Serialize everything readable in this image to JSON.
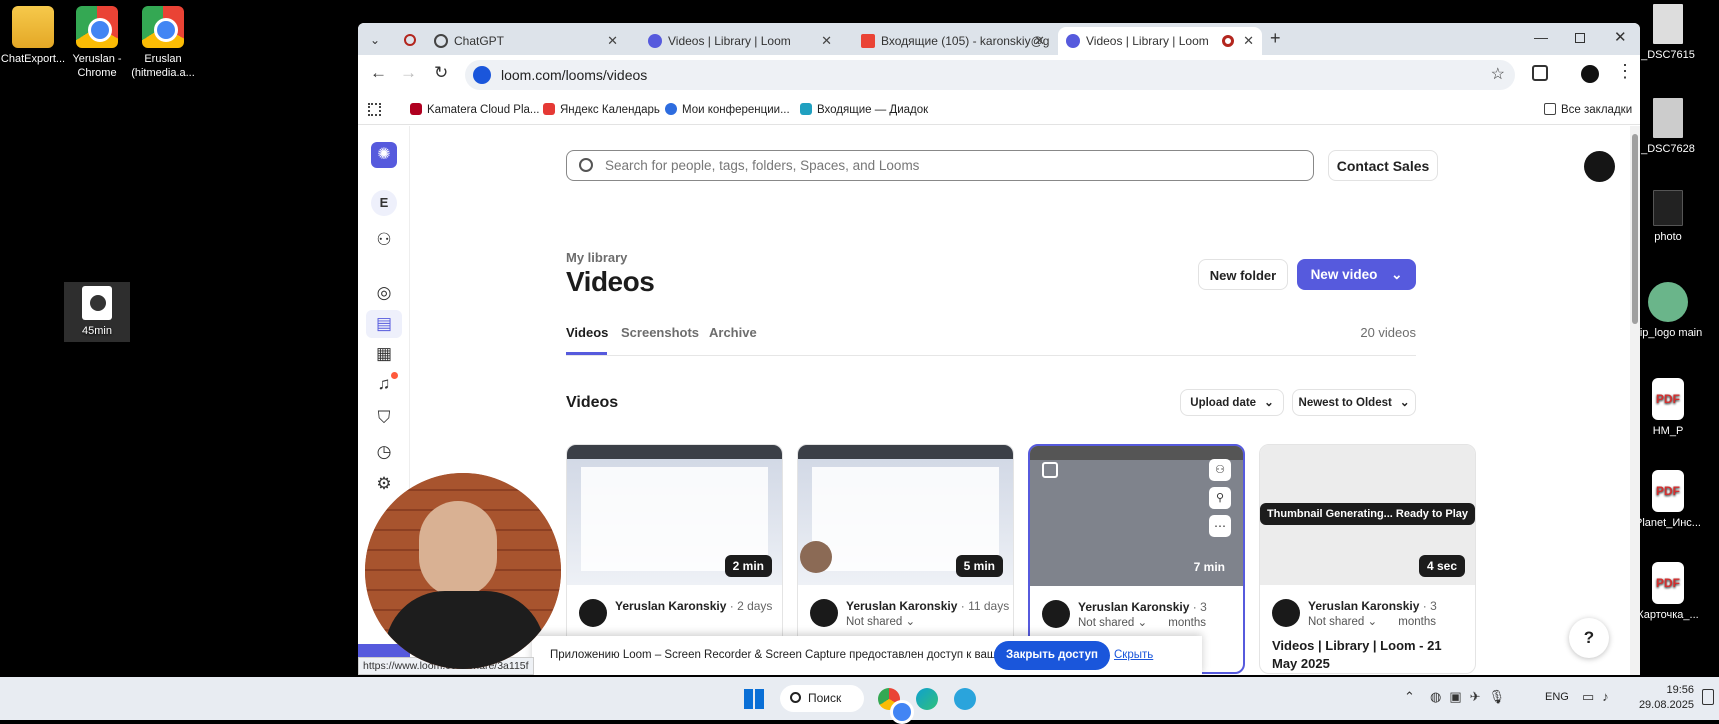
{
  "desktop": {
    "left_icons": [
      {
        "label": "ChatExport..."
      },
      {
        "label": "Yeruslan - Chrome"
      },
      {
        "label": "Eruslan (hitmedia.a..."
      },
      {
        "label": "45min"
      }
    ],
    "right_icons": [
      {
        "label": "_DSC7615"
      },
      {
        "label": "_DSC7628"
      },
      {
        "label": "photo"
      },
      {
        "label": "dip_logo main"
      },
      {
        "label": "HM_P"
      },
      {
        "label": "Planet_Инс..."
      },
      {
        "label": "Карточка_..."
      }
    ]
  },
  "browser": {
    "tabs": [
      {
        "title": "ChatGPT"
      },
      {
        "title": "Videos | Library | Loom"
      },
      {
        "title": "Входящие (105) - karonskiy@g"
      },
      {
        "title": "Videos | Library | Loom"
      }
    ],
    "url": "loom.com/looms/videos",
    "bookmarks": [
      "Kamatera Cloud Pla...",
      "Яндекс Календарь",
      "Мои конференции...",
      "Входящие — Диадок"
    ],
    "all_bookmarks": "Все закладки",
    "status_url": "https://www.loom.com/share/3a115f"
  },
  "loom": {
    "rail_avatar_letter": "E",
    "search_placeholder": "Search for people, tags, folders, Spaces, and Looms",
    "contact_sales": "Contact Sales",
    "breadcrumb": "My library",
    "title": "Videos",
    "new_folder": "New folder",
    "new_video": "New video",
    "tabs": [
      "Videos",
      "Screenshots",
      "Archive"
    ],
    "count": "20 videos",
    "section_title": "Videos",
    "sort_field": "Upload date",
    "sort_order": "Newest to Oldest",
    "cards": [
      {
        "duration": "2 min",
        "author": "Yeruslan Karonskiy",
        "ago": "· 2 days",
        "share": ""
      },
      {
        "duration": "5 min",
        "author": "Yeruslan Karonskiy",
        "ago": "· 11 days",
        "share": "Not shared"
      },
      {
        "duration": "7 min",
        "author": "Yeruslan Karonskiy",
        "ago": "· 3",
        "ago2": "months",
        "share": "Not shared"
      },
      {
        "duration": "4 sec",
        "author": "Yeruslan Karonskiy",
        "ago": "· 3",
        "ago2": "months",
        "share": "Not shared",
        "generating": "Thumbnail Generating... Ready to Play",
        "title": "Videos | Library | Loom - 21 May 2025"
      }
    ],
    "share_banner": {
      "text": "Приложению Loom – Screen Recorder & Screen Capture предоставлен доступ к вашему экрану.",
      "stop": "Закрыть доступ",
      "hide": "Скрыть"
    },
    "help": "?"
  },
  "taskbar": {
    "search": "Поиск",
    "lang": "ENG",
    "time": "19:56",
    "date": "29.08.2025"
  },
  "colors": {
    "accent": "#565add",
    "rail_bg": "#ffffff"
  }
}
